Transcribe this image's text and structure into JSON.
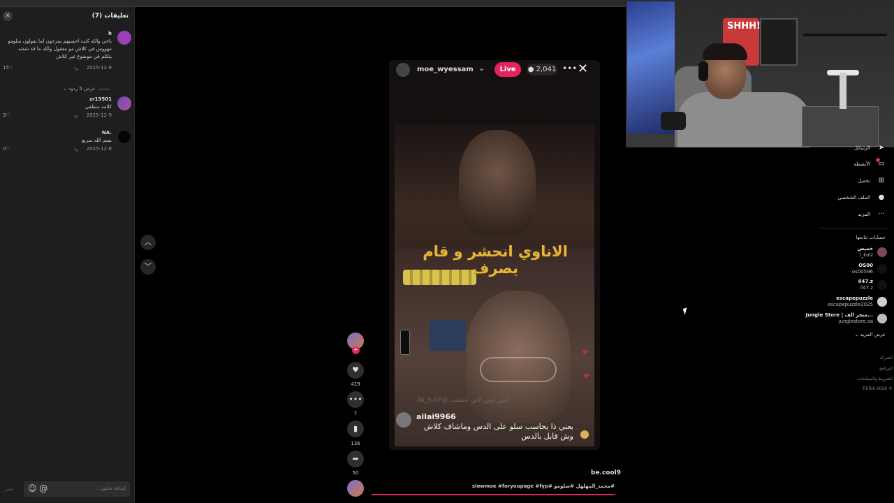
{
  "comments_panel": {
    "title": "تعليقات (7)",
    "comments": [
      {
        "user": "h",
        "text": "ياخي والله كنت احسبهم يمزحون لما يقولون سلومو مهووس في كلاش مو معقول والله ما قد شفته يتكلم في موضوع غير كلاش",
        "date": "2025-12-9",
        "reply": "رد",
        "likes": "15"
      },
      {
        "user": "zr19501",
        "text": "كلامه منطقي",
        "date": "2025-12-9",
        "reply": "رد",
        "likes": "3"
      },
      {
        "user": "NA.",
        "text": "بسم الله سريع",
        "date": "2025-12-8",
        "reply": "رد",
        "likes": "0"
      }
    ],
    "view_replies": "عرض 5 ردود",
    "composer_placeholder": "إضافة تعليق...",
    "post_label": "نشر"
  },
  "video": {
    "username": "moe_wyessam",
    "live_label": "Live",
    "viewers": "2,041",
    "caption_overlay": "الاناوي انحشر و قام يصرف",
    "faint_text": "امين امين لاني عمشت @ila_5.07",
    "comment_user": "ailai9966",
    "comment_text": "يعني ذا يحاسب سلو على الدس وماشاف كلاش وش قابل بالدس",
    "progress": 0.99
  },
  "rail": {
    "likes": "419",
    "comments": "7",
    "saves": "136",
    "shares": "50"
  },
  "description": {
    "user": "be.cool9",
    "tags": "#محمد_المهلهل #سلومو #slowmoe #foryoupage #fyp"
  },
  "right_nav": {
    "items": [
      {
        "label": "الرسائل",
        "icon": "send-icon"
      },
      {
        "label": "الأنشطة",
        "icon": "inbox-icon"
      },
      {
        "label": "تحميل",
        "icon": "upload-icon"
      },
      {
        "label": "الملف الشخصي",
        "icon": "profile-icon"
      },
      {
        "label": "المزيد",
        "icon": "more-icon"
      }
    ],
    "following_title": "حسابات تتابعها",
    "following": [
      {
        "name": "خميس",
        "handle": "l_kolz"
      },
      {
        "name": "OS00",
        "handle": "os00596"
      },
      {
        "name": "il47.z",
        "handle": "il47.z"
      },
      {
        "name": "escapepuzzle",
        "handle": "escapepuzzle2025"
      },
      {
        "name": "Jungle Store | متجر الف...",
        "handle": "junglestore.sa"
      }
    ],
    "see_more": "عرض المزيد",
    "footer": [
      "الشركة",
      "البرنامج",
      "الشروط والسياسات",
      "© 2026 TikTok"
    ]
  }
}
